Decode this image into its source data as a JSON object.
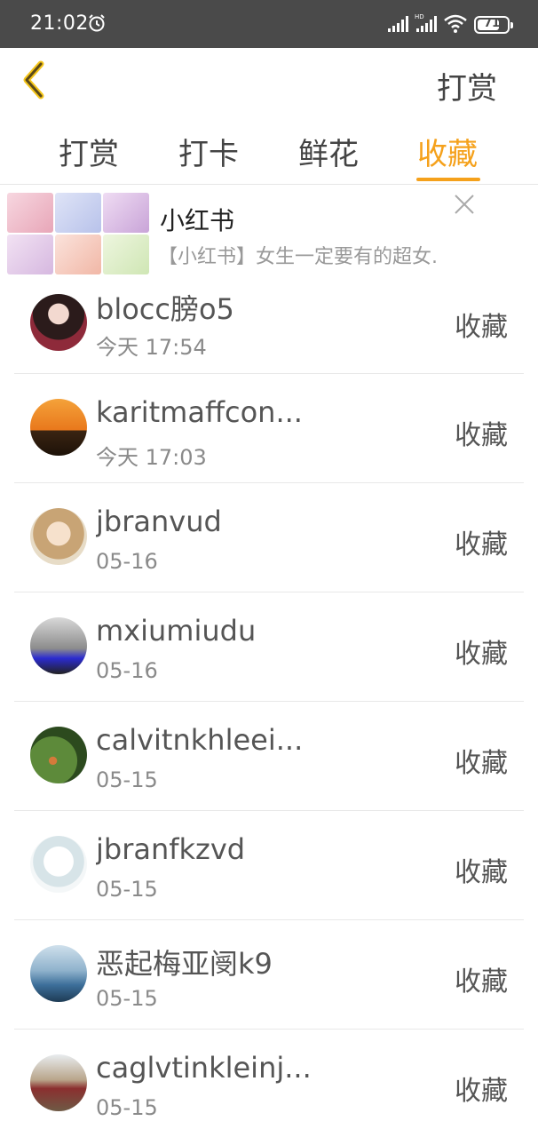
{
  "status_bar": {
    "time": "21:02",
    "battery": "71"
  },
  "header": {
    "title": "打赏"
  },
  "tabs": [
    {
      "label": "打赏"
    },
    {
      "label": "打卡"
    },
    {
      "label": "鲜花"
    },
    {
      "label": "收藏",
      "active": true
    }
  ],
  "ad": {
    "title": "小红书",
    "description": "【小红书】女生一定要有的超女."
  },
  "list": [
    {
      "name": "blocc膀o5",
      "date": "今天 17:54",
      "action": "收藏",
      "avatar_color": "#8e2a3a"
    },
    {
      "name": "karitmaffcon...",
      "date": "今天 17:03",
      "action": "收藏",
      "avatar_color": "#e9781c"
    },
    {
      "name": "jbranvud",
      "date": "05-16",
      "action": "收藏",
      "avatar_color": "#d8c7a8"
    },
    {
      "name": "mxiumiudu",
      "date": "05-16",
      "action": "收藏",
      "avatar_color": "#6b6b6b"
    },
    {
      "name": "calvitnkhleei...",
      "date": "05-15",
      "action": "收藏",
      "avatar_color": "#3c6a2b"
    },
    {
      "name": "jbranfkzvd",
      "date": "05-15",
      "action": "收藏",
      "avatar_color": "#e8eef0"
    },
    {
      "name": "恶起梅亚阌k9",
      "date": "05-15",
      "action": "收藏",
      "avatar_color": "#3d6f9a"
    },
    {
      "name": "caglvtinkleinj...",
      "date": "05-15",
      "action": "收藏",
      "avatar_color": "#b9a58a"
    }
  ],
  "colors": {
    "accent": "#f5a11b",
    "status_bar": "#4a4a4a"
  }
}
